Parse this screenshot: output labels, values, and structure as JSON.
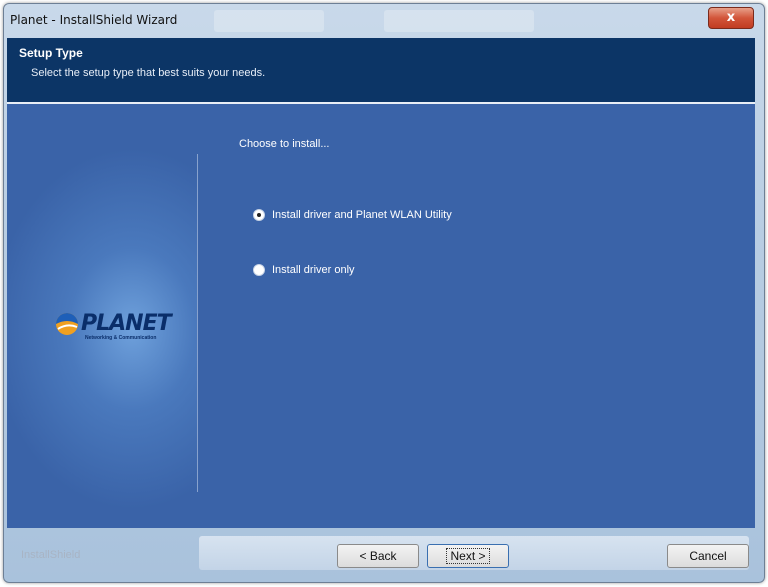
{
  "window": {
    "title": "Planet - InstallShield Wizard",
    "close_glyph": "x"
  },
  "header": {
    "title": "Setup Type",
    "subtitle": "Select the setup type that best suits your needs."
  },
  "main": {
    "prompt": "Choose to install...",
    "options": [
      {
        "label": "Install driver and Planet WLAN Utility",
        "selected": true
      },
      {
        "label": "Install driver only",
        "selected": false
      }
    ]
  },
  "brand": {
    "logo_text": "PLANET",
    "logo_tagline": "Networking & Communication"
  },
  "footer": {
    "brand": "InstallShield",
    "back_label": "< Back",
    "next_label": "Next >",
    "cancel_label": "Cancel"
  },
  "colors": {
    "header_bg": "#0c3566",
    "content_bg": "#3a63a8",
    "close_button": "#c13c22"
  }
}
